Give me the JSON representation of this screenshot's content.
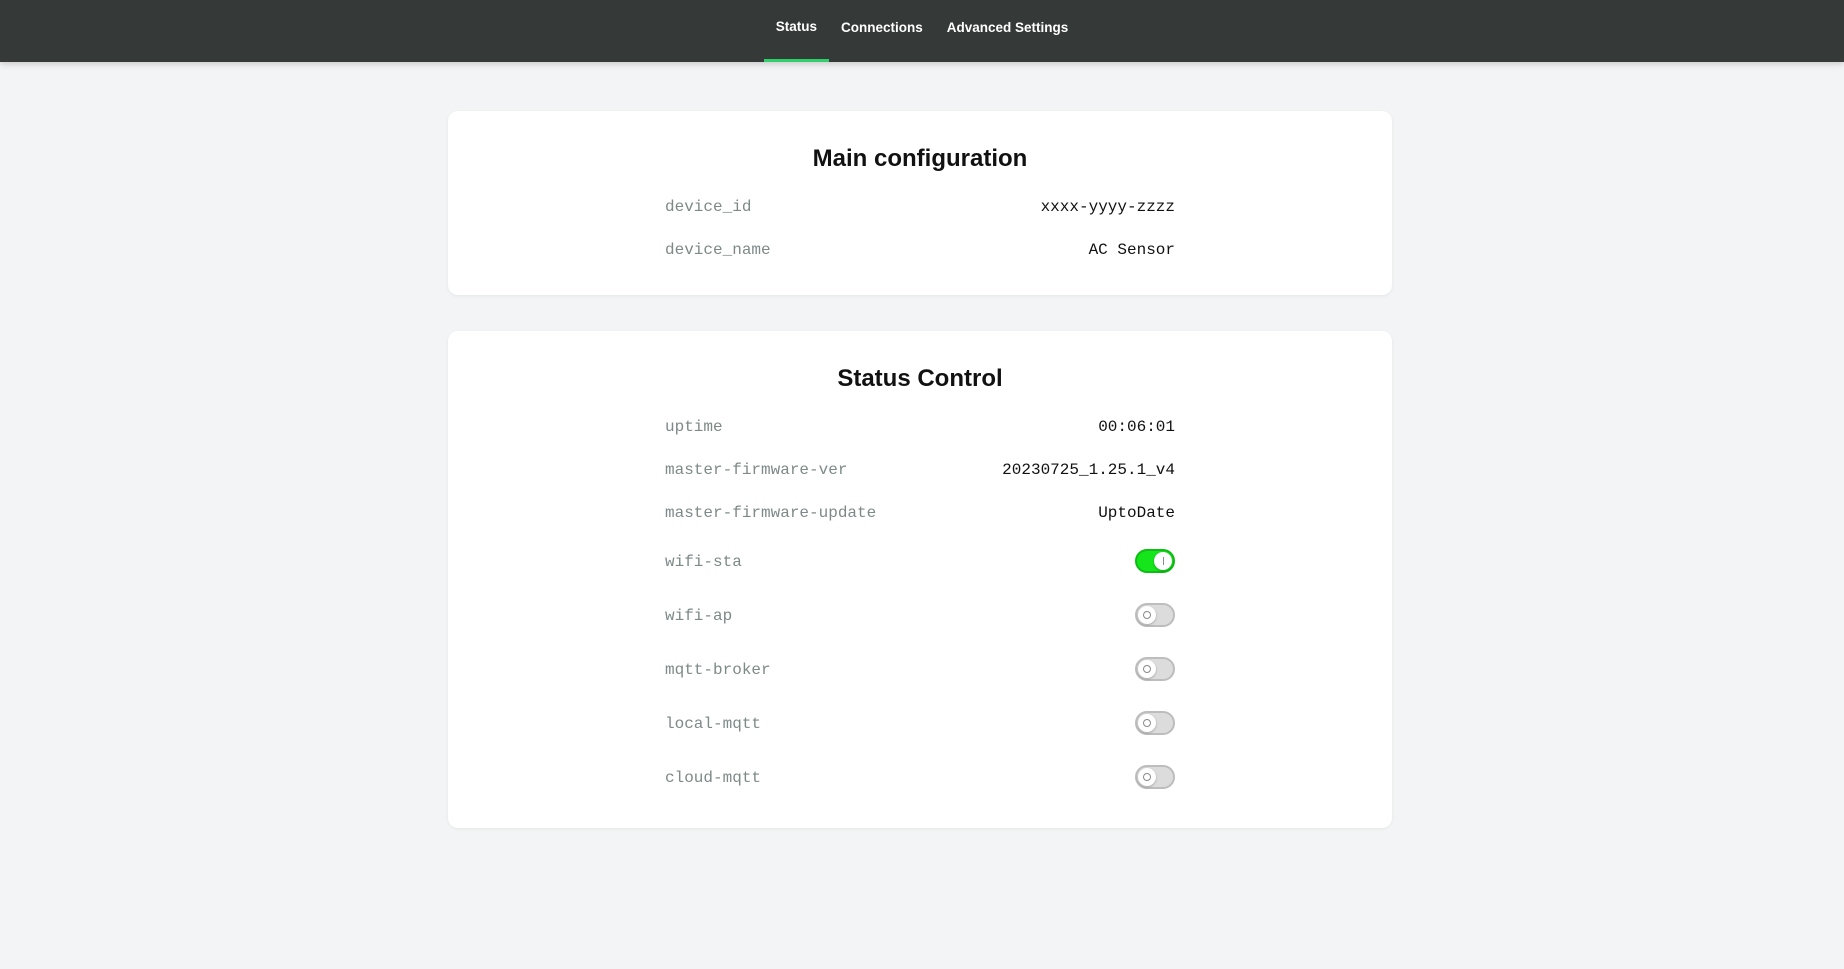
{
  "nav": {
    "tabs": [
      {
        "label": "Status",
        "active": true
      },
      {
        "label": "Connections",
        "active": false
      },
      {
        "label": "Advanced Settings",
        "active": false
      }
    ],
    "accent_color": "#2fd06b"
  },
  "main_config": {
    "title": "Main configuration",
    "rows": [
      {
        "label": "device_id",
        "value": "xxxx-yyyy-zzzz"
      },
      {
        "label": "device_name",
        "value": "AC Sensor"
      }
    ]
  },
  "status_control": {
    "title": "Status Control",
    "rows": [
      {
        "label": "uptime",
        "value": "00:06:01"
      },
      {
        "label": "master-firmware-ver",
        "value": "20230725_1.25.1_v4"
      },
      {
        "label": "master-firmware-update",
        "value": "UptoDate"
      }
    ],
    "toggles": [
      {
        "label": "wifi-sta",
        "on": true
      },
      {
        "label": "wifi-ap",
        "on": false
      },
      {
        "label": "mqtt-broker",
        "on": false
      },
      {
        "label": "local-mqtt",
        "on": false
      },
      {
        "label": "cloud-mqtt",
        "on": false
      }
    ],
    "toggle_on_color": "#15e51b",
    "toggle_off_color": "#dcdcdc"
  }
}
